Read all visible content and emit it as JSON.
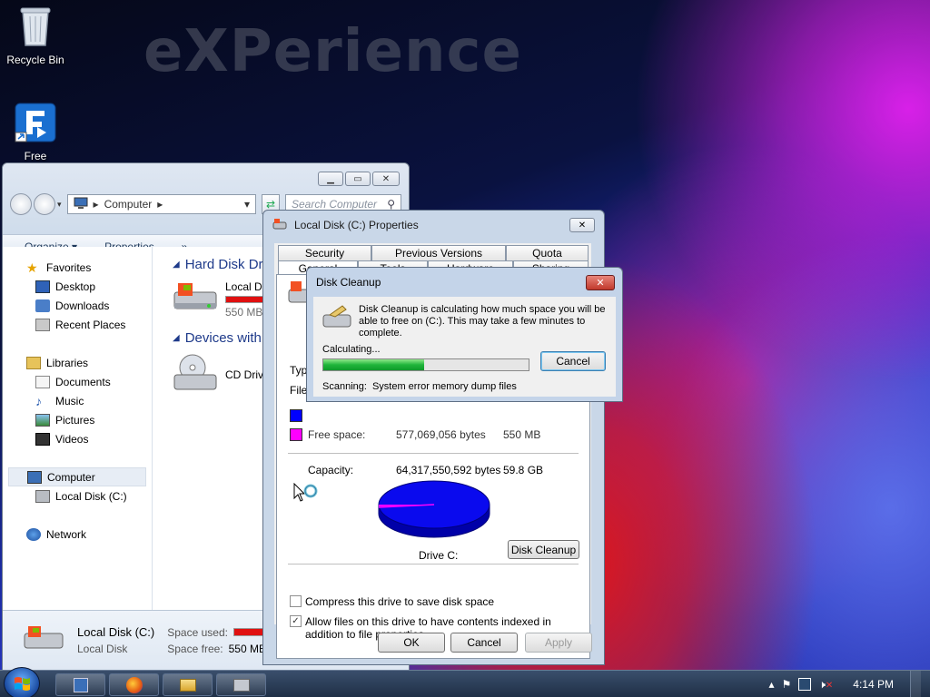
{
  "desktop": {
    "watermark": "eXPerience",
    "icons": [
      {
        "label": "Recycle Bin"
      },
      {
        "label": "Free"
      }
    ]
  },
  "explorer": {
    "address": {
      "crumb": "Computer"
    },
    "search_placeholder": "Search Computer",
    "toolbar": {
      "organize": "Organize",
      "properties": "Properties",
      "more": "»"
    },
    "nav": {
      "favorites": "Favorites",
      "desktop": "Desktop",
      "downloads": "Downloads",
      "recent": "Recent Places",
      "libraries": "Libraries",
      "documents": "Documents",
      "music": "Music",
      "pictures": "Pictures",
      "videos": "Videos",
      "computer": "Computer",
      "local_disk": "Local Disk (C:)",
      "network": "Network"
    },
    "content": {
      "group1": "Hard Disk Drive",
      "drive1_name": "Local Disk",
      "drive1_free": "550 MB fr",
      "group2": "Devices with Re",
      "drive2_name": "CD Drive"
    },
    "details": {
      "name": "Local Disk (C:)",
      "type": "Local Disk",
      "space_used_label": "Space used:",
      "space_free_label": "Space free:",
      "space_free_value": "550 MB"
    }
  },
  "properties": {
    "title": "Local Disk (C:) Properties",
    "tabs_row1": [
      "Security",
      "Previous Versions",
      "Quota"
    ],
    "tabs_row2": [
      "General",
      "Tools",
      "Hardware",
      "Sharing"
    ],
    "type_label": "Typ",
    "file_label": "File",
    "free_space_label": "Free space:",
    "free_space_bytes": "577,069,056 bytes",
    "free_space_mb": "550 MB",
    "capacity_label": "Capacity:",
    "capacity_bytes": "64,317,550,592 bytes",
    "capacity_gb": "59.8 GB",
    "drive_label": "Drive C:",
    "disk_cleanup_button": "Disk Cleanup",
    "compress_label": "Compress this drive to save disk space",
    "index_label": "Allow files on this drive to have contents indexed in addition to file properties",
    "ok": "OK",
    "cancel": "Cancel",
    "apply": "Apply",
    "colors": {
      "used": "#0000ff",
      "free": "#ff00ff"
    },
    "used_fraction": 0.991
  },
  "cleanup": {
    "title": "Disk Cleanup",
    "message": "Disk Cleanup is calculating how much space you will be able to free on  (C:). This may take a few minutes to complete.",
    "calculating": "Calculating...",
    "cancel": "Cancel",
    "scanning_label": "Scanning:",
    "scanning_item": "System error memory dump files",
    "progress": 0.49
  },
  "taskbar": {
    "clock": "4:14 PM"
  }
}
